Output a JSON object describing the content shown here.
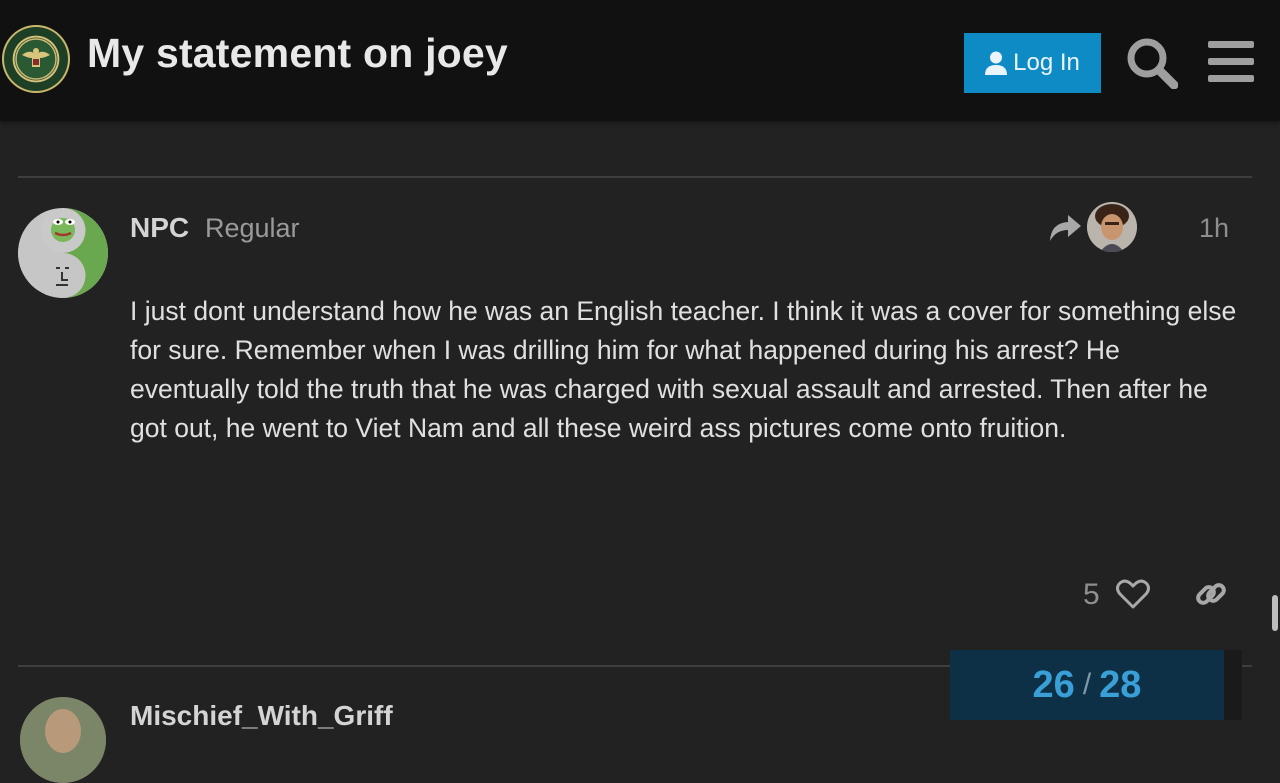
{
  "header": {
    "logo_text": "INFOWARS ARMY",
    "title": "My statement on joey",
    "login_label": "Log In",
    "icons": [
      "person-icon",
      "search-icon",
      "hamburger-menu-icon"
    ]
  },
  "post": {
    "username": "NPC",
    "user_title": "Regular",
    "time": "1h",
    "body": "I just dont understand how he was an English teacher. I think it was a cover for something else for sure. Remember when I was drilling him for what happened during his arrest? He eventually told the truth that he was charged with sexual assault and arrested. Then after he got out, he went to Viet Nam and all these weird ass pictures come onto fruition.",
    "like_count": "5",
    "icons": [
      "reply-arrow-icon",
      "heart-icon",
      "link-icon"
    ]
  },
  "next_post": {
    "username": "Mischief_With_Griff"
  },
  "progress": {
    "current": "26",
    "separator": "/",
    "total": "28"
  },
  "colors": {
    "background": "#222222",
    "header_bg": "#111111",
    "accent": "#0e8ac5",
    "progress_bg": "#0d3046"
  }
}
